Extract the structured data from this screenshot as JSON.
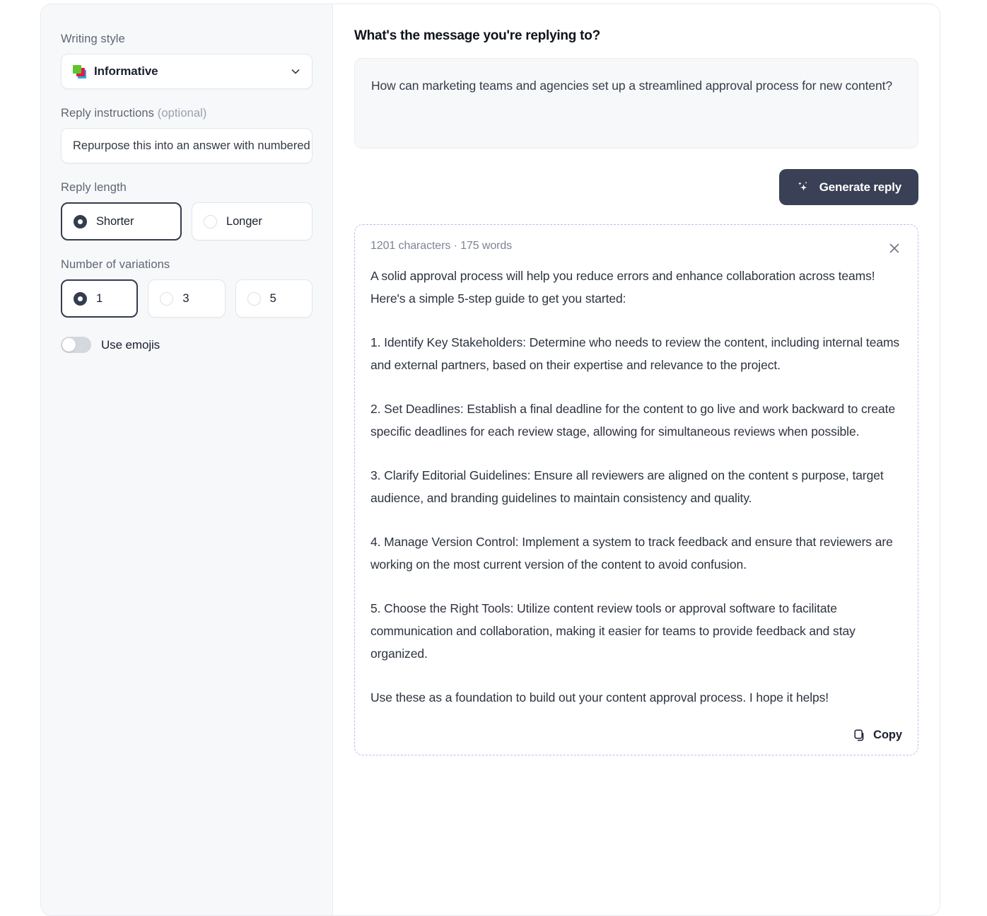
{
  "sidebar": {
    "writing_style": {
      "label": "Writing style",
      "value": "Informative",
      "icon": "layers-stack-icon",
      "chevron_icon": "chevron-down-icon"
    },
    "reply_instructions": {
      "label": "Reply instructions ",
      "label_optional": "(optional)",
      "value": "Repurpose this into an answer with numbered steps",
      "placeholder": "Reply instructions (optional)"
    },
    "reply_length": {
      "label": "Reply length",
      "options": [
        {
          "label": "Shorter",
          "selected": true
        },
        {
          "label": "Longer",
          "selected": false
        }
      ]
    },
    "variations": {
      "label": "Number of variations",
      "options": [
        {
          "label": "1",
          "selected": true
        },
        {
          "label": "3",
          "selected": false
        },
        {
          "label": "5",
          "selected": false
        }
      ]
    },
    "use_emojis": {
      "label": "Use emojis",
      "enabled": false
    }
  },
  "main": {
    "title": "What's the message you're replying to?",
    "message": "How can marketing teams and agencies set up a streamlined approval process for new content?",
    "generate_button": {
      "label": "Generate reply",
      "icon": "sparkles-icon"
    },
    "result": {
      "meta": "1201 characters · 175 words",
      "close_icon": "close-icon",
      "paragraphs": [
        "A solid approval process will help you reduce errors and enhance collaboration across teams! Here's a simple 5-step guide to get you started:",
        "1. Identify Key Stakeholders: Determine who needs to review the content, including internal teams and external partners, based on their expertise and relevance to the project.",
        "2. Set Deadlines: Establish a final deadline for the content to go live and work backward to create specific deadlines for each review stage, allowing for simultaneous reviews when possible.",
        "3. Clarify Editorial Guidelines: Ensure all reviewers are aligned on the content s purpose, target audience, and branding guidelines to maintain consistency and quality.",
        "4. Manage Version Control: Implement a system to track feedback and ensure that reviewers are working on the most current version of the content to avoid confusion.",
        "5. Choose the Right Tools: Utilize content review tools or approval software to facilitate communication and collaboration, making it easier for teams to provide feedback and stay organized.",
        "Use these as a foundation to build out your content approval process. I hope it helps!"
      ],
      "copy_button": {
        "label": "Copy",
        "icon": "copy-icon"
      }
    }
  },
  "colors": {
    "accent_dark": "#3a4055",
    "result_border": "#c8b6ec",
    "sidebar_bg": "#f7f8fa",
    "icon_green": "#5ec52a",
    "icon_pink": "#e8174a",
    "icon_blue": "#29ade3"
  }
}
